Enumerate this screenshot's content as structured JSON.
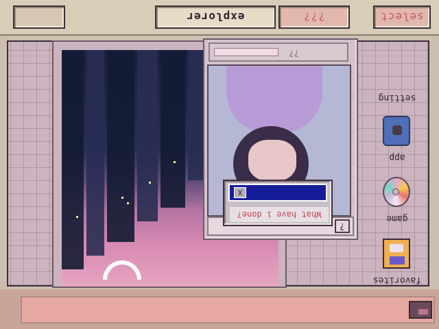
{
  "taskbar": {
    "explorer_label": "explorer",
    "unknown_label": "???",
    "select_label": "select"
  },
  "desktop_icons": {
    "favorites": "favorites",
    "game": "game",
    "app": "app",
    "setting": "setting"
  },
  "portrait_window": {
    "header_label": "??",
    "question_label": "?"
  },
  "dialog": {
    "title": "What have i done?",
    "close_glyph": "X"
  },
  "icons": [
    "floppy-disk-icon",
    "compact-disc-icon",
    "mug-icon",
    "tray-icon",
    "close-icon"
  ],
  "colors": {
    "accent": "#c45a62",
    "dialog_bar": "#161c98",
    "desktop": "#cbb4bf"
  }
}
